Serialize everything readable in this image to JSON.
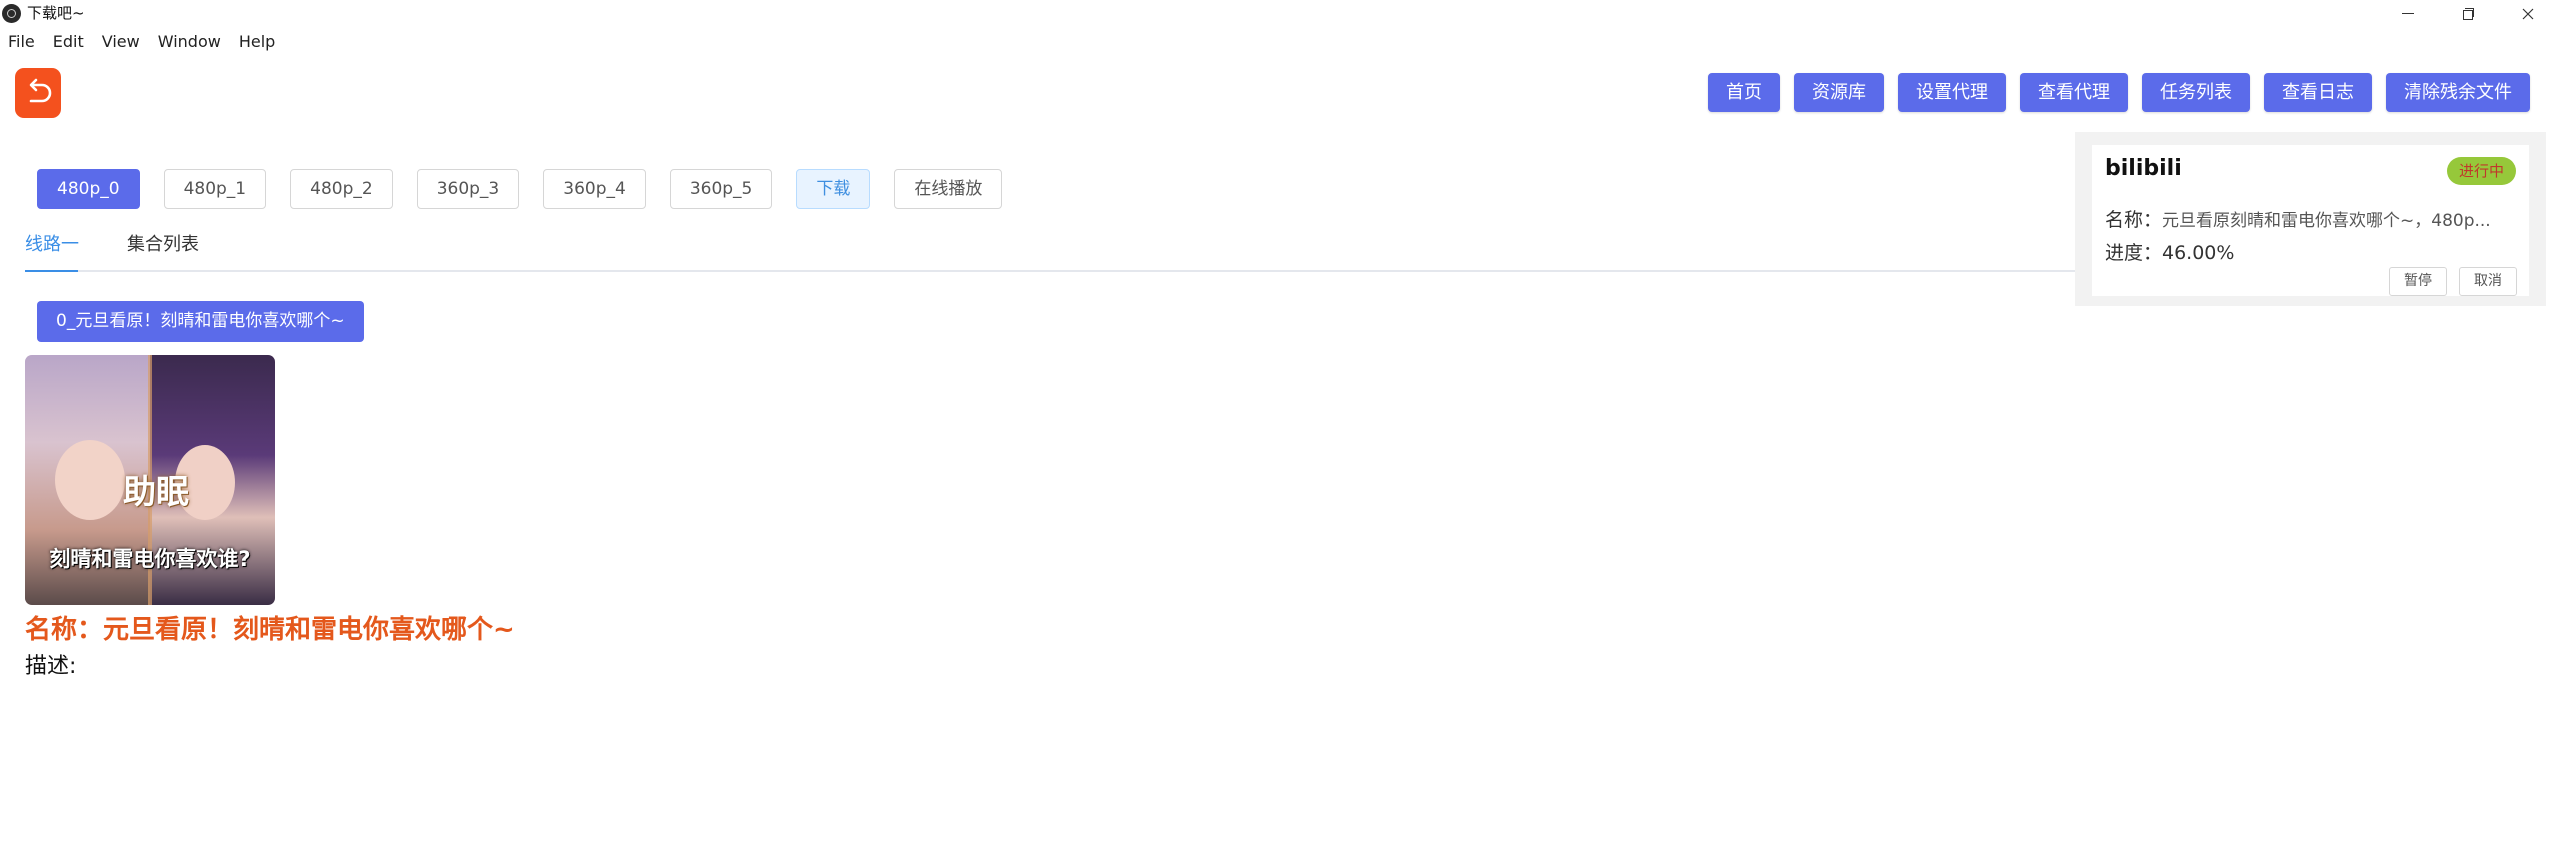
{
  "window": {
    "title": "下载吧~",
    "menu": [
      "File",
      "Edit",
      "View",
      "Window",
      "Help"
    ]
  },
  "top_nav": [
    "首页",
    "资源库",
    "设置代理",
    "查看代理",
    "任务列表",
    "查看日志",
    "清除残余文件"
  ],
  "quality_options": [
    {
      "label": "480p_0",
      "state": "selected"
    },
    {
      "label": "480p_1",
      "state": "default"
    },
    {
      "label": "480p_2",
      "state": "default"
    },
    {
      "label": "360p_3",
      "state": "default"
    },
    {
      "label": "360p_4",
      "state": "default"
    },
    {
      "label": "360p_5",
      "state": "default"
    },
    {
      "label": "下载",
      "state": "light"
    },
    {
      "label": "在线播放",
      "state": "default"
    }
  ],
  "tabs": [
    {
      "label": "线路一",
      "active": true
    },
    {
      "label": "集合列表",
      "active": false
    }
  ],
  "episode": {
    "label": "0_元旦看原！刻晴和雷电你喜欢哪个~"
  },
  "thumbnail": {
    "overlay_top": "助眠",
    "overlay_bottom": "刻晴和雷电你喜欢谁?"
  },
  "video": {
    "name": "名称：元旦看原！刻晴和雷电你喜欢哪个~",
    "description": "描述:"
  },
  "task": {
    "site": "bilibili",
    "status": "进行中",
    "name_label": "名称：",
    "name_value": "元旦看原刻晴和雷电你喜欢哪个~，480p...",
    "progress": "进度：46.00%",
    "pause_label": "暂停",
    "cancel_label": "取消"
  },
  "colors": {
    "primary": "#5b6bea",
    "accent_orange": "#f4511e",
    "title_orange": "#e4581c",
    "tab_active": "#3a8ee6",
    "badge_green": "#96c83a"
  }
}
